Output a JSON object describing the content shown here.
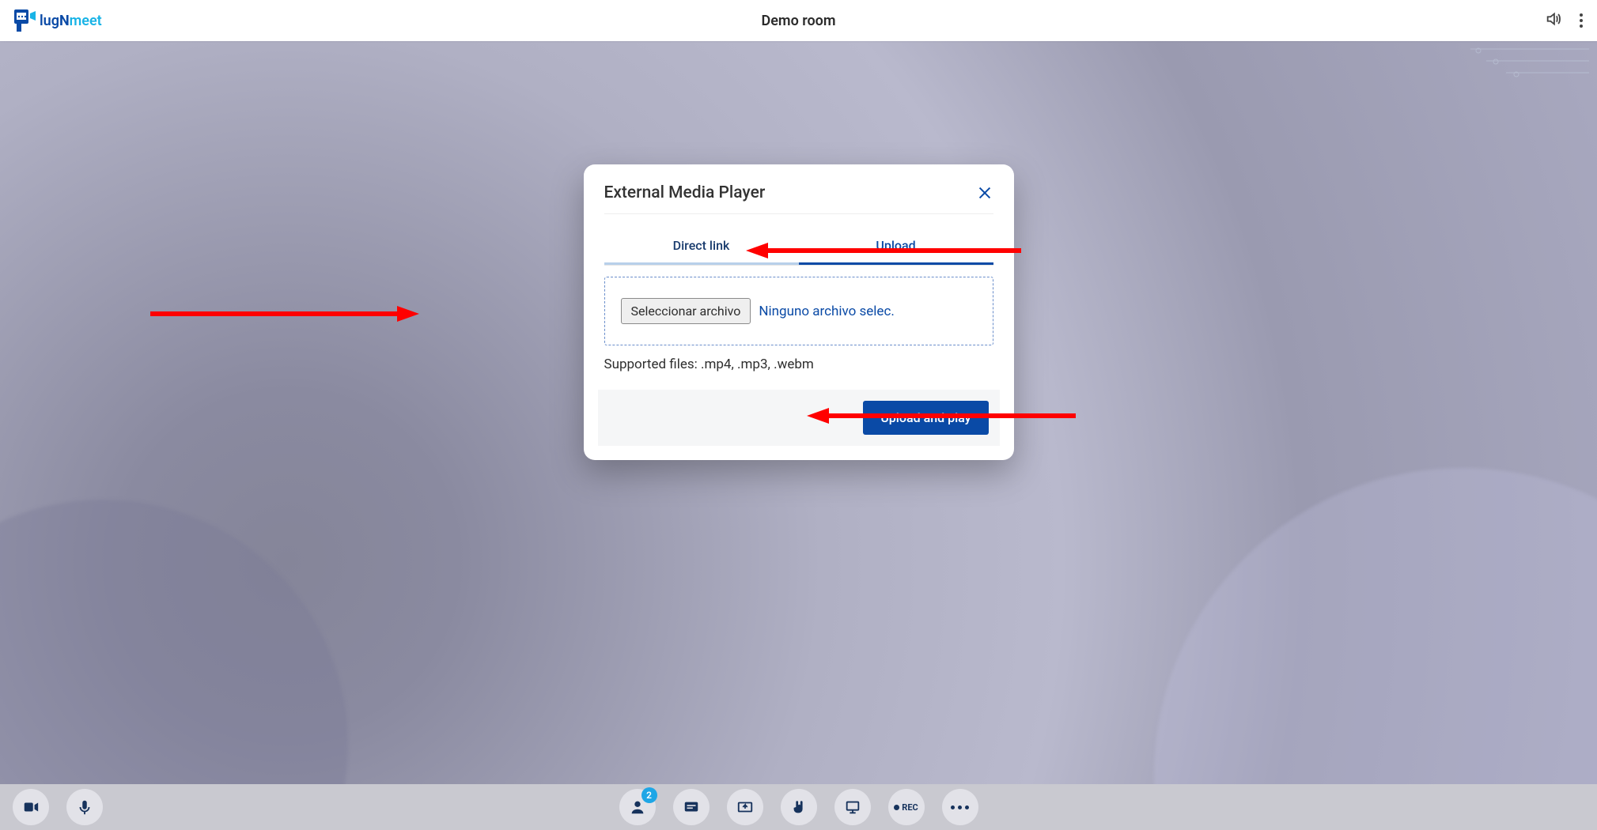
{
  "header": {
    "room_title": "Demo room",
    "logo_parts": {
      "prefix": "lug",
      "mid": "N",
      "suffix": "meet"
    }
  },
  "modal": {
    "title": "External Media Player",
    "tabs": {
      "directlink": "Direct link",
      "upload": "Upload"
    },
    "file_button": "Seleccionar archivo",
    "file_status": "Ninguno archivo selec.",
    "hint": "Supported files: .mp4, .mp3, .webm",
    "submit": "Upload and play"
  },
  "footer": {
    "participants_badge": "2",
    "rec_label": "REC"
  }
}
